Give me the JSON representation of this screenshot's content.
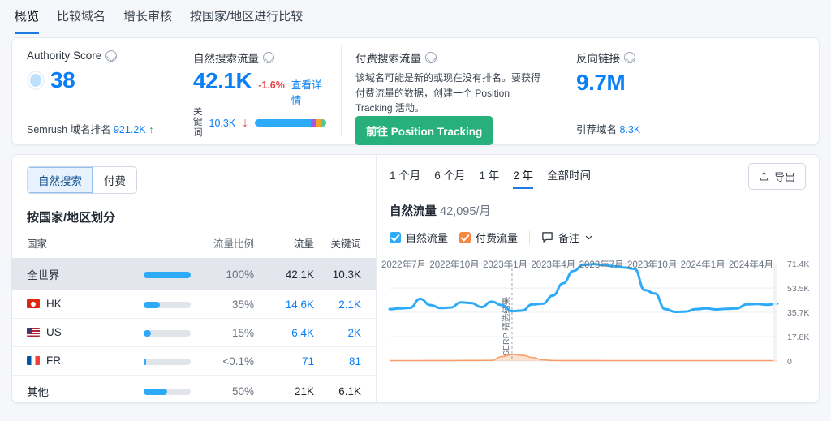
{
  "tabs": [
    {
      "label": "概览",
      "active": true
    },
    {
      "label": "比较域名",
      "active": false
    },
    {
      "label": "增长审核",
      "active": false
    },
    {
      "label": "按国家/地区进行比较",
      "active": false
    }
  ],
  "metrics": {
    "authority": {
      "title": "Authority Score",
      "value": "38",
      "foot_label": "Semrush 域名排名",
      "foot_value": "921.2K",
      "foot_arrow": "↑"
    },
    "organic": {
      "title": "自然搜索流量",
      "value": "42.1K",
      "change": "-1.6%",
      "details_link": "查看详情",
      "kw_label": "关键词",
      "kw_value": "10.3K",
      "kw_arrow": "↓",
      "bar_segments": [
        {
          "color": "#2eabf8",
          "pct": 78
        },
        {
          "color": "#a857e8",
          "pct": 7
        },
        {
          "color": "#f5a623",
          "pct": 7
        },
        {
          "color": "#4ecb9c",
          "pct": 8
        }
      ]
    },
    "paid": {
      "title": "付费搜索流量",
      "description": "该域名可能是新的或现在没有排名。要获得付费流量的数据，创建一个 Position Tracking 活动。",
      "cta": "前往 Position Tracking",
      "cta_color": "#27b07b"
    },
    "backlinks": {
      "title": "反向链接",
      "value": "9.7M",
      "foot_label": "引荐域名",
      "foot_value": "8.3K"
    }
  },
  "left": {
    "toggle": [
      {
        "label": "自然搜索",
        "active": true
      },
      {
        "label": "付费",
        "active": false
      }
    ],
    "title": "按国家/地区划分",
    "columns": [
      "国家",
      "流量比例",
      "流量",
      "关键词"
    ],
    "rows": [
      {
        "country": "全世界",
        "flag": "none",
        "bar": 100,
        "share": "100%",
        "traffic": "42.1K",
        "keywords": "10.3K",
        "highlight": true,
        "link": false
      },
      {
        "country": "HK",
        "flag": "hk",
        "bar": 35,
        "share": "35%",
        "traffic": "14.6K",
        "keywords": "2.1K",
        "highlight": false,
        "link": true
      },
      {
        "country": "US",
        "flag": "us",
        "bar": 15,
        "share": "15%",
        "traffic": "6.4K",
        "keywords": "2K",
        "highlight": false,
        "link": true
      },
      {
        "country": "FR",
        "flag": "fr",
        "bar": 1,
        "share": "<0.1%",
        "traffic": "71",
        "keywords": "81",
        "highlight": false,
        "link": true
      },
      {
        "country": "其他",
        "flag": "none",
        "bar": 50,
        "share": "50%",
        "traffic": "21K",
        "keywords": "6.1K",
        "highlight": false,
        "link": false
      }
    ]
  },
  "right": {
    "periods": [
      {
        "label": "1 个月",
        "active": false
      },
      {
        "label": "6 个月",
        "active": false
      },
      {
        "label": "1 年",
        "active": false
      },
      {
        "label": "2 年",
        "active": true
      },
      {
        "label": "全部时间",
        "active": false
      }
    ],
    "export_label": "导出",
    "traffic_label": "自然流量",
    "traffic_value": "42,095/月",
    "legend": [
      {
        "label": "自然流量",
        "color": "#2eabf8",
        "checked": true
      },
      {
        "label": "付费流量",
        "color": "#f5863f",
        "checked": true
      }
    ],
    "notes_label": "备注"
  },
  "chart_data": {
    "type": "line",
    "title": "自然流量 42,095/月",
    "xlabel": "",
    "ylabel": "",
    "ylim": [
      0,
      71400
    ],
    "yticks": [
      0,
      17800,
      35700,
      53500,
      71400
    ],
    "ytick_labels": [
      "0",
      "17.8K",
      "35.7K",
      "53.5K",
      "71.4K"
    ],
    "xtick_labels": [
      "2022年7月",
      "2022年10月",
      "2023年1月",
      "2023年4月",
      "2023年7月",
      "2023年10月",
      "2024年1月",
      "2024年4月"
    ],
    "grid": true,
    "legend_position": "top-left",
    "annotations": [
      {
        "text": "SERP 精选结果",
        "x_index": 12,
        "style": "vertical-dashed"
      }
    ],
    "series": [
      {
        "name": "自然流量",
        "color": "#2eabf8",
        "values": [
          38000,
          38500,
          39000,
          45500,
          41000,
          38800,
          39200,
          43000,
          42500,
          39500,
          43500,
          41000,
          36500,
          37000,
          41500,
          42000,
          48000,
          57000,
          66000,
          70500,
          71000,
          70200,
          69500,
          68500,
          67500,
          52000,
          49500,
          38000,
          36000,
          36200,
          38000,
          38500,
          37800,
          38200,
          38500,
          41500,
          41800,
          41200,
          42095
        ]
      },
      {
        "name": "付费流量",
        "color": "#f5863f",
        "values": [
          300,
          300,
          300,
          300,
          320,
          330,
          350,
          400,
          420,
          450,
          500,
          3200,
          4800,
          4200,
          2600,
          900,
          400,
          350,
          330,
          320,
          310,
          300,
          300,
          300,
          300,
          300,
          300,
          300,
          300,
          300,
          300,
          300,
          300,
          300,
          300,
          300,
          300,
          300,
          300
        ]
      }
    ]
  }
}
